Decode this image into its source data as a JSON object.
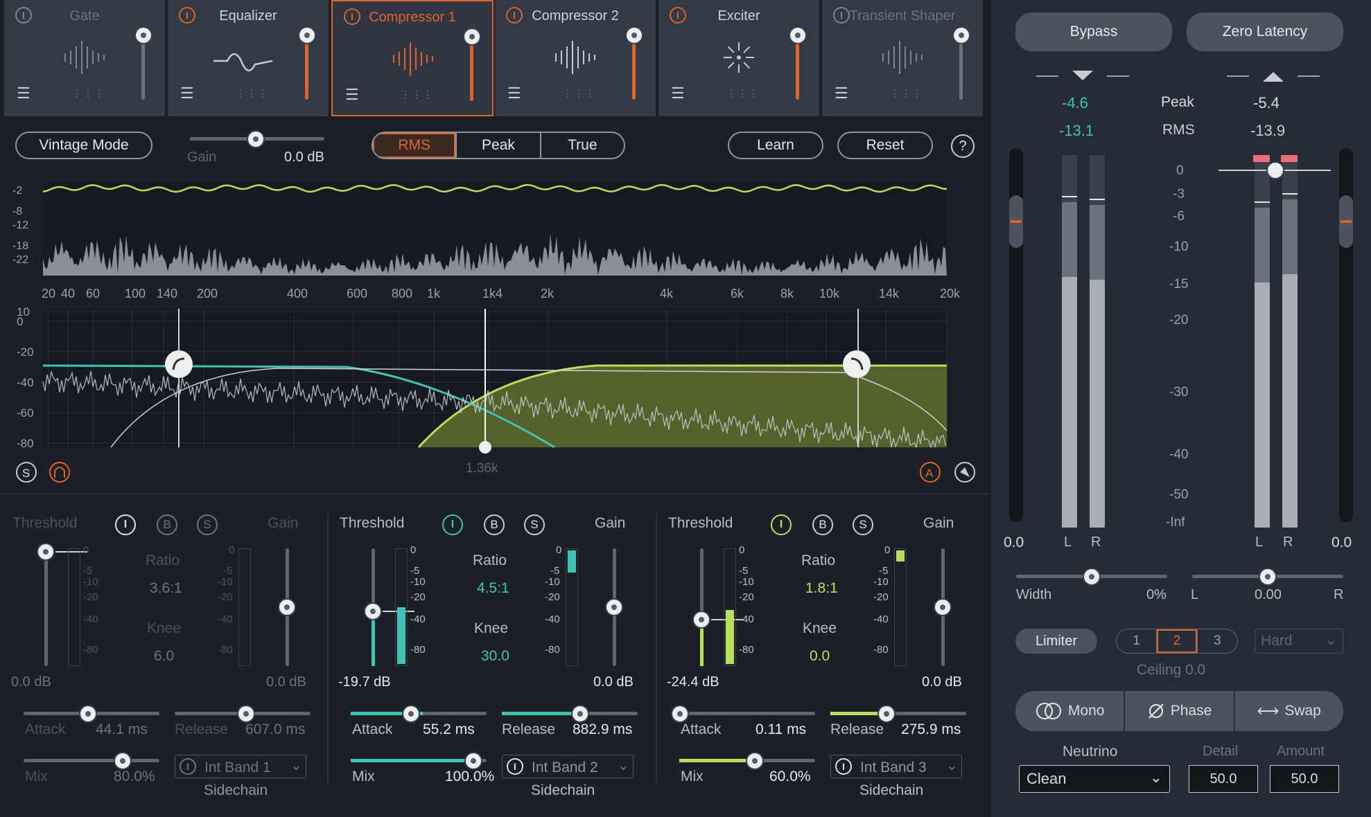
{
  "modules": [
    {
      "name": "Gate",
      "active": false,
      "enabled": false
    },
    {
      "name": "Equalizer",
      "active": false,
      "enabled": true
    },
    {
      "name": "Compressor 1",
      "active": true,
      "enabled": true
    },
    {
      "name": "Compressor 2",
      "active": false,
      "enabled": true
    },
    {
      "name": "Exciter",
      "active": false,
      "enabled": true
    },
    {
      "name": "Transient Shaper",
      "active": false,
      "enabled": false
    }
  ],
  "toolbar": {
    "vintage_label": "Vintage Mode",
    "gain_label": "Gain",
    "gain_value": "0.0 dB",
    "detect_modes": [
      "RMS",
      "Peak",
      "True"
    ],
    "detect_selected": "RMS",
    "learn_label": "Learn",
    "reset_label": "Reset",
    "help_label": "?"
  },
  "spectrum": {
    "db_ticks": [
      "-2",
      "-8",
      "-12",
      "-18",
      "-22"
    ],
    "freq_ticks": [
      "20",
      "40",
      "60",
      "100",
      "140",
      "200",
      "400",
      "600",
      "800",
      "1k",
      "1k4",
      "2k",
      "4k",
      "6k",
      "8k",
      "10k",
      "14k",
      "20k"
    ],
    "eq_db_ticks": [
      "10",
      "0",
      "-20",
      "-40",
      "-60",
      "-80"
    ],
    "crossover_readout": "1.36k",
    "solo_label": "S",
    "auto_label": "A"
  },
  "bands": [
    {
      "threshold_label": "Threshold",
      "gain_label": "Gain",
      "bypass": "B",
      "solo": "S",
      "ratio_label": "Ratio",
      "ratio_value": "3.6:1",
      "knee_label": "Knee",
      "knee_value": "6.0",
      "threshold_value": "0.0 dB",
      "gain_value": "0.0 dB",
      "meter_ticks": [
        "0",
        "-5",
        "-10",
        "-20",
        "-40",
        "-80"
      ],
      "attack_label": "Attack",
      "attack_value": "44.1 ms",
      "release_label": "Release",
      "release_value": "607.0 ms",
      "mix_label": "Mix",
      "mix_value": "80.0%",
      "sidechain_label": "Int Band 1",
      "sidechain_caption": "Sidechain",
      "mix_fraction": 0.8,
      "enabled": false,
      "color": "#6b737d"
    },
    {
      "threshold_label": "Threshold",
      "gain_label": "Gain",
      "bypass": "B",
      "solo": "S",
      "ratio_label": "Ratio",
      "ratio_value": "4.5:1",
      "knee_label": "Knee",
      "knee_value": "30.0",
      "threshold_value": "-19.7 dB",
      "gain_value": "0.0 dB",
      "meter_ticks": [
        "0",
        "-5",
        "-10",
        "-20",
        "-40",
        "-80"
      ],
      "attack_label": "Attack",
      "attack_value": "55.2 ms",
      "release_label": "Release",
      "release_value": "882.9 ms",
      "mix_label": "Mix",
      "mix_value": "100.0%",
      "sidechain_label": "Int Band 2",
      "sidechain_caption": "Sidechain",
      "mix_fraction": 1.0,
      "enabled": true,
      "color": "#3ec3b4"
    },
    {
      "threshold_label": "Threshold",
      "gain_label": "Gain",
      "bypass": "B",
      "solo": "S",
      "ratio_label": "Ratio",
      "ratio_value": "1.8:1",
      "knee_label": "Knee",
      "knee_value": "0.0",
      "threshold_value": "-24.4 dB",
      "gain_value": "0.0 dB",
      "meter_ticks": [
        "0",
        "-5",
        "-10",
        "-20",
        "-40",
        "-80"
      ],
      "attack_label": "Attack",
      "attack_value": "0.11 ms",
      "release_label": "Release",
      "release_value": "275.9 ms",
      "mix_label": "Mix",
      "mix_value": "60.0%",
      "sidechain_label": "Int Band 3",
      "sidechain_caption": "Sidechain",
      "mix_fraction": 0.6,
      "enabled": true,
      "color": "#b9e05a"
    }
  ],
  "right": {
    "bypass_label": "Bypass",
    "zero_latency_label": "Zero Latency",
    "in_peak": "-4.6",
    "in_rms": "-13.1",
    "peak_label": "Peak",
    "rms_label": "RMS",
    "out_peak": "-5.4",
    "out_rms": "-13.9",
    "scale": [
      "0",
      "-3",
      "-6",
      "-10",
      "-15",
      "-20",
      "-30",
      "-40",
      "-50",
      "-Inf"
    ],
    "in_gain": "0.0",
    "out_gain": "0.0",
    "left_ch": "L",
    "right_ch": "R",
    "width_label": "Width",
    "width_value": "0%",
    "pan_l": "L",
    "pan_value": "0.00",
    "pan_r": "R",
    "limiter_label": "Limiter",
    "limiter_modes": [
      "1",
      "2",
      "3"
    ],
    "limiter_selected": "2",
    "limiter_type": "Hard",
    "ceiling_label": "Ceiling 0.0",
    "mono_label": "Mono",
    "phase_label": "Phase",
    "swap_label": "Swap",
    "neutrino_label": "Neutrino",
    "neutrino_value": "Clean",
    "detail_label": "Detail",
    "detail_value": "50.0",
    "amount_label": "Amount",
    "amount_value": "50.0"
  },
  "colors": {
    "accent": "#e0642a",
    "band2": "#3ec3b4",
    "band3": "#b9e05a",
    "panel": "#323a45"
  }
}
